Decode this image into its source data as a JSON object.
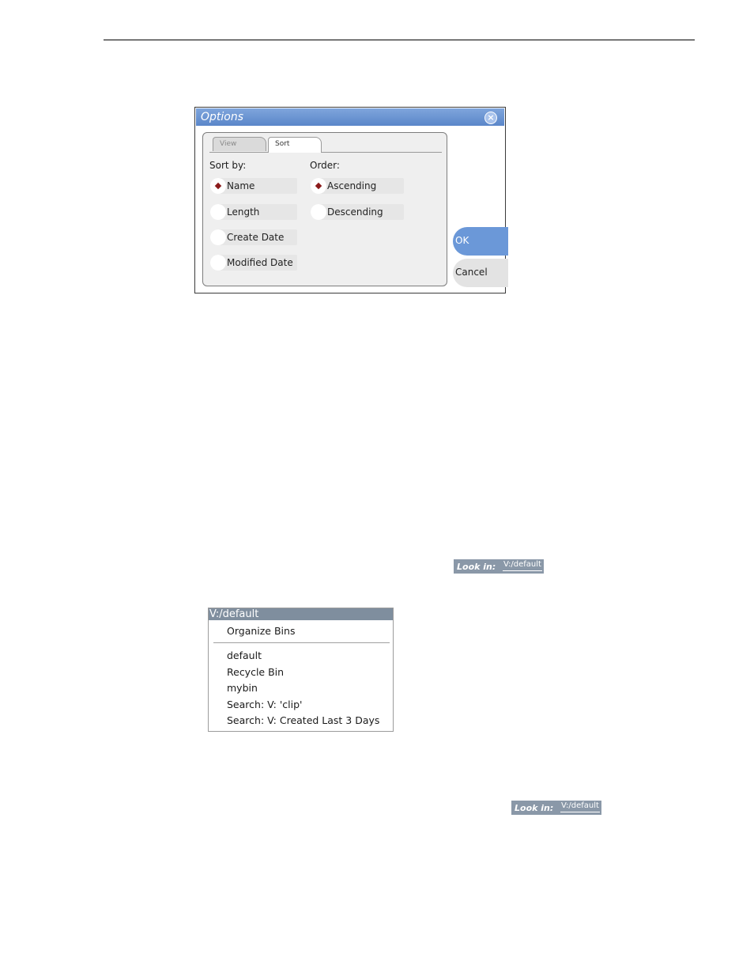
{
  "options_dialog": {
    "title": "Options",
    "close_glyph": "×",
    "tabs": [
      {
        "label": "View"
      },
      {
        "label": "Sort"
      }
    ],
    "sort_by_label": "Sort by:",
    "order_label": "Order:",
    "sort_by_options": [
      {
        "label": "Name",
        "selected": true
      },
      {
        "label": "Length",
        "selected": false
      },
      {
        "label": "Create Date",
        "selected": false
      },
      {
        "label": "Modified Date",
        "selected": false
      }
    ],
    "order_options": [
      {
        "label": "Ascending",
        "selected": true
      },
      {
        "label": "Descending",
        "selected": false
      }
    ],
    "ok_label": "OK",
    "cancel_label": "Cancel"
  },
  "look_in_1": {
    "label": "Look in:",
    "value": "V:/default"
  },
  "bin_menu": {
    "header": "V:/default",
    "items": [
      {
        "label": "Organize Bins"
      },
      {
        "label": "default"
      },
      {
        "label": "Recycle Bin"
      },
      {
        "label": "mybin"
      },
      {
        "label": "Search: V: 'clip'"
      },
      {
        "label": "Search: V: Created Last 3 Days"
      }
    ]
  },
  "look_in_2": {
    "label": "Look in:",
    "value": "V:/default"
  },
  "colors": {
    "title_bar": "#6b98d8",
    "ok_button": "#6b98d8",
    "radio_dot": "#8b1a1a",
    "menu_header": "#7f8e9e"
  }
}
